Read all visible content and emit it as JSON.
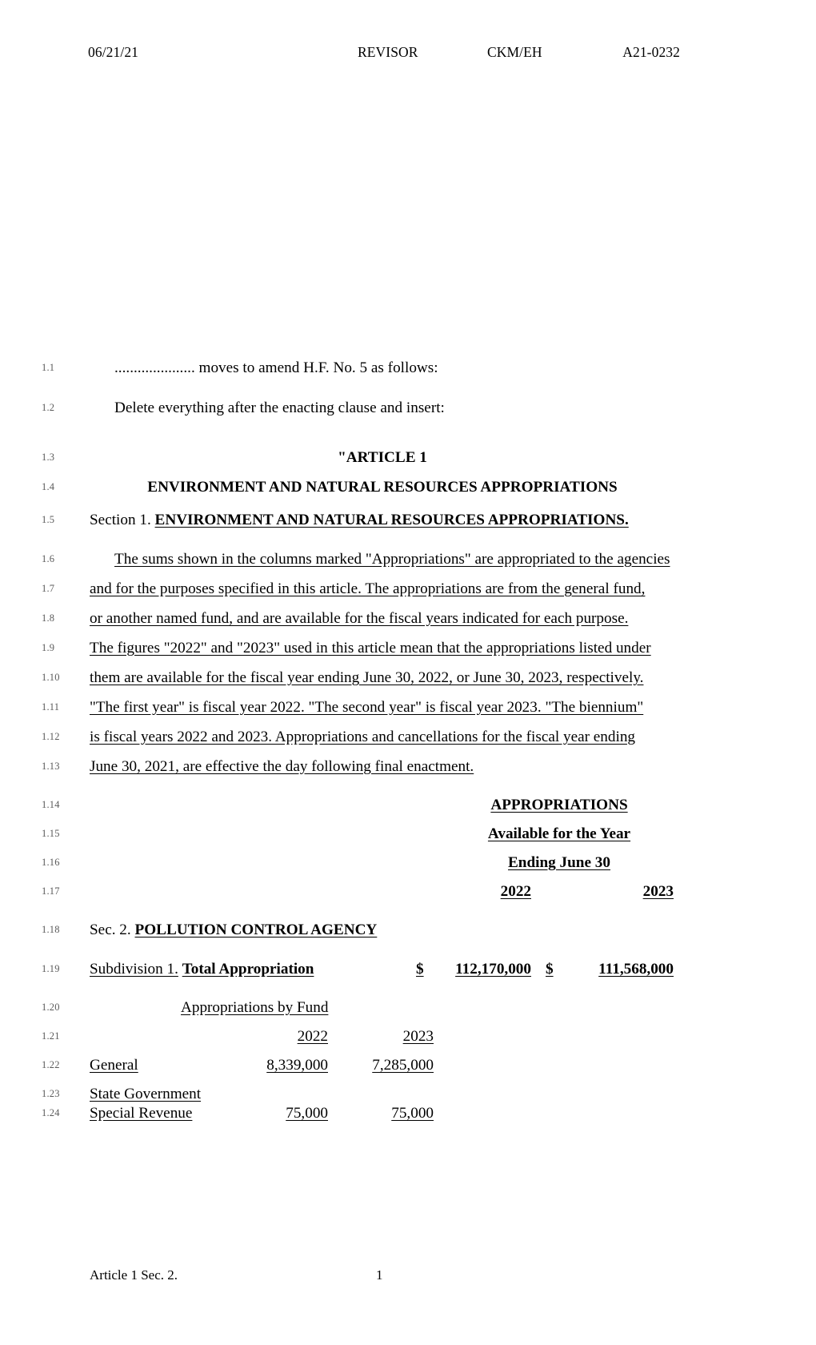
{
  "header": {
    "date": "06/21/21",
    "revisor": "REVISOR",
    "initials": "CKM/EH",
    "doc_id": "A21-0232"
  },
  "lines": {
    "n1_1": "1.1",
    "n1_2": "1.2",
    "n1_3": "1.3",
    "n1_4": "1.4",
    "n1_5": "1.5",
    "n1_6": "1.6",
    "n1_7": "1.7",
    "n1_8": "1.8",
    "n1_9": "1.9",
    "n1_10": "1.10",
    "n1_11": "1.11",
    "n1_12": "1.12",
    "n1_13": "1.13",
    "n1_14": "1.14",
    "n1_15": "1.15",
    "n1_16": "1.16",
    "n1_17": "1.17",
    "n1_18": "1.18",
    "n1_19": "1.19",
    "n1_20": "1.20",
    "n1_21": "1.21",
    "n1_22": "1.22",
    "n1_23": "1.23",
    "n1_24": "1.24"
  },
  "motion": {
    "line_1_1": "..................... moves to amend H.F. No. 5 as follows:",
    "line_1_2": "Delete everything after the enacting clause and insert:"
  },
  "article": {
    "title": "\"ARTICLE 1",
    "subtitle": "ENVIRONMENT AND NATURAL RESOURCES APPROPRIATIONS"
  },
  "section1": {
    "label": "Section 1.",
    "heading": "ENVIRONMENT AND NATURAL RESOURCES APPROPRIATIONS."
  },
  "paragraph": {
    "line_1_6": "The sums shown in the columns marked \"Appropriations\" are appropriated to the agencies",
    "line_1_7": "and for the purposes specified in this article. The appropriations are from the general fund,",
    "line_1_8": "or another named fund, and are available for the fiscal years indicated for each purpose.",
    "line_1_9": "The figures \"2022\" and \"2023\" used in this article mean that the appropriations listed under",
    "line_1_10": "them are available for the fiscal year ending June 30, 2022, or June 30, 2023, respectively.",
    "line_1_11": "\"The first year\" is fiscal year 2022. \"The second year\" is fiscal year 2023. \"The biennium\"",
    "line_1_12": "is fiscal years 2022 and 2023. Appropriations and cancellations for the fiscal year ending",
    "line_1_13": "June 30, 2021, are effective the day following final enactment."
  },
  "column_headers": {
    "line_1_14": "APPROPRIATIONS",
    "line_1_15": "Available for the Year",
    "line_1_16": "Ending June 30",
    "year_2022": "2022",
    "year_2023": "2023"
  },
  "section2": {
    "label": "Sec. 2.",
    "heading": "POLLUTION CONTROL AGENCY"
  },
  "subdivision1": {
    "label": "Subdivision 1.",
    "heading": "Total Appropriation",
    "dollar_sign_2022": "$",
    "amount_2022": "112,170,000",
    "dollar_sign_2023": "$",
    "amount_2023": "111,568,000"
  },
  "fund_table": {
    "title": "Appropriations by Fund",
    "year_2022": "2022",
    "year_2023": "2023",
    "rows": [
      {
        "name": "General",
        "name_line2": "",
        "amount_2022": "8,339,000",
        "amount_2023": "7,285,000"
      },
      {
        "name": "State Government",
        "name_line2": "Special Revenue",
        "amount_2022": "75,000",
        "amount_2023": "75,000"
      }
    ]
  },
  "footer": {
    "article_sec": "Article 1 Sec. 2.",
    "page_number": "1"
  }
}
